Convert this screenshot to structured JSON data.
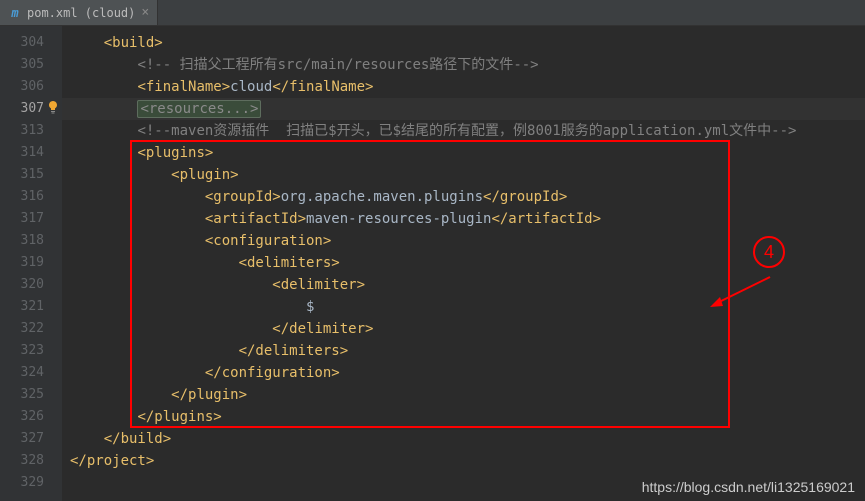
{
  "tab": {
    "filename": "pom.xml (cloud)",
    "icon_letter": "m"
  },
  "line_numbers": [
    "304",
    "305",
    "306",
    "307",
    "313",
    "314",
    "315",
    "316",
    "317",
    "318",
    "319",
    "320",
    "321",
    "322",
    "323",
    "324",
    "325",
    "326",
    "327",
    "328",
    "329"
  ],
  "active_line_index": 3,
  "code": {
    "l0": {
      "indent": "    ",
      "open": "<build>",
      "content": "",
      "close": ""
    },
    "l1": {
      "indent": "        ",
      "open": "<!-- ",
      "content": "扫描父工程所有src/main/resources路径下的文件",
      "close": "-->"
    },
    "l2": {
      "indent": "        ",
      "open": "<finalName>",
      "content": "cloud",
      "close": "</finalName>"
    },
    "l3": {
      "indent": "        ",
      "open": "<resources",
      "content": "...",
      "close": ">"
    },
    "l4": {
      "indent": "        ",
      "open": "<!--",
      "content": "maven资源插件  扫描已$开头，已$结尾的所有配置，例8001服务的application.yml文件中",
      "close": "-->"
    },
    "l5": {
      "indent": "        ",
      "open": "<plugins>",
      "content": "",
      "close": ""
    },
    "l6": {
      "indent": "            ",
      "open": "<plugin>",
      "content": "",
      "close": ""
    },
    "l7": {
      "indent": "                ",
      "open": "<groupId>",
      "content": "org.apache.maven.plugins",
      "close": "</groupId>"
    },
    "l8": {
      "indent": "                ",
      "open": "<artifactId>",
      "content": "maven-resources-plugin",
      "close": "</artifactId>"
    },
    "l9": {
      "indent": "                ",
      "open": "<configuration>",
      "content": "",
      "close": ""
    },
    "l10": {
      "indent": "                    ",
      "open": "<delimiters>",
      "content": "",
      "close": ""
    },
    "l11": {
      "indent": "                        ",
      "open": "<delimiter>",
      "content": "",
      "close": ""
    },
    "l12": {
      "indent": "                            ",
      "open": "",
      "content": "$",
      "close": ""
    },
    "l13": {
      "indent": "                        ",
      "open": "",
      "content": "",
      "close": "</delimiter>"
    },
    "l14": {
      "indent": "                    ",
      "open": "",
      "content": "",
      "close": "</delimiters>"
    },
    "l15": {
      "indent": "                ",
      "open": "",
      "content": "",
      "close": "</configuration>"
    },
    "l16": {
      "indent": "            ",
      "open": "",
      "content": "",
      "close": "</plugin>"
    },
    "l17": {
      "indent": "        ",
      "open": "",
      "content": "",
      "close": "</plugins>"
    },
    "l18": {
      "indent": "    ",
      "open": "",
      "content": "",
      "close": "</build>"
    },
    "l19": {
      "indent": "",
      "open": "",
      "content": "",
      "close": "</project>"
    },
    "l20": {
      "indent": "",
      "open": "",
      "content": "",
      "close": ""
    }
  },
  "annotation": {
    "number": "4"
  },
  "watermark": "https://blog.csdn.net/li1325169021"
}
